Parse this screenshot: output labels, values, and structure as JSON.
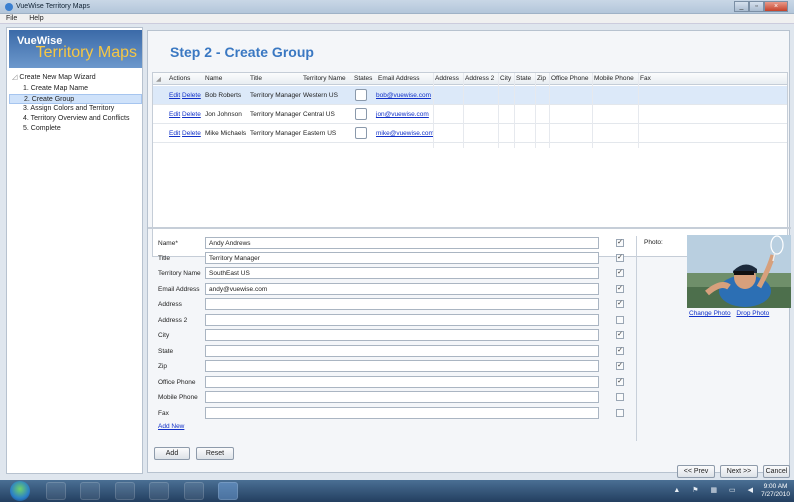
{
  "window": {
    "title": "VueWise Territory Maps"
  },
  "menu": [
    "File",
    "Help"
  ],
  "logo": {
    "line1": "VueWise",
    "line2": "Territory Maps"
  },
  "wizard": {
    "header": "Create New Map Wizard",
    "steps": [
      "1. Create Map Name",
      "2. Create Group",
      "3. Assign Colors and Territory",
      "4. Territory Overview and Conflicts",
      "5. Complete"
    ],
    "selected_step": 2
  },
  "page": {
    "title": "Step 2 - Create Group"
  },
  "grid": {
    "columns": [
      "Actions",
      "Name",
      "Title",
      "Territory Name",
      "States",
      "Email Address",
      "Address",
      "Address 2",
      "City",
      "State",
      "Zip",
      "Office Phone",
      "Mobile Phone",
      "Fax"
    ],
    "edit_label": "Edit",
    "delete_label": "Delete",
    "rows": [
      {
        "name": "Bob Roberts",
        "title": "Territory Manager",
        "territory": "Western US",
        "email": "bob@vuewise.com"
      },
      {
        "name": "Jon Johnson",
        "title": "Territory Manager",
        "territory": "Central US",
        "email": "jon@vuewise.com"
      },
      {
        "name": "Mike Michaels",
        "title": "Territory Manager",
        "territory": "Eastern US",
        "email": "mike@vuewise.com"
      }
    ]
  },
  "form": {
    "fields": [
      {
        "label": "Name*",
        "value": "Andy Andrews",
        "checked": true
      },
      {
        "label": "Title",
        "value": "Territory Manager",
        "checked": true
      },
      {
        "label": "Territory Name",
        "value": "SouthEast US",
        "checked": true
      },
      {
        "label": "Email Address",
        "value": "andy@vuewise.com",
        "checked": true
      },
      {
        "label": "Address",
        "value": "",
        "checked": true
      },
      {
        "label": "Address 2",
        "value": "",
        "checked": false
      },
      {
        "label": "City",
        "value": "",
        "checked": true
      },
      {
        "label": "State",
        "value": "",
        "checked": true
      },
      {
        "label": "Zip",
        "value": "",
        "checked": true
      },
      {
        "label": "Office Phone",
        "value": "",
        "checked": true
      },
      {
        "label": "Mobile Phone",
        "value": "",
        "checked": false
      },
      {
        "label": "Fax",
        "value": "",
        "checked": false
      }
    ],
    "add_new": "Add New",
    "photo_label": "Photo:",
    "change_photo": "Change Photo",
    "drop_photo": "Drop Photo",
    "add_button": "Add",
    "reset_button": "Reset"
  },
  "nav": {
    "prev": "<< Prev",
    "next": "Next >>",
    "cancel": "Cancel"
  },
  "taskbar": {
    "time": "9:00 AM",
    "date": "7/27/2010"
  }
}
